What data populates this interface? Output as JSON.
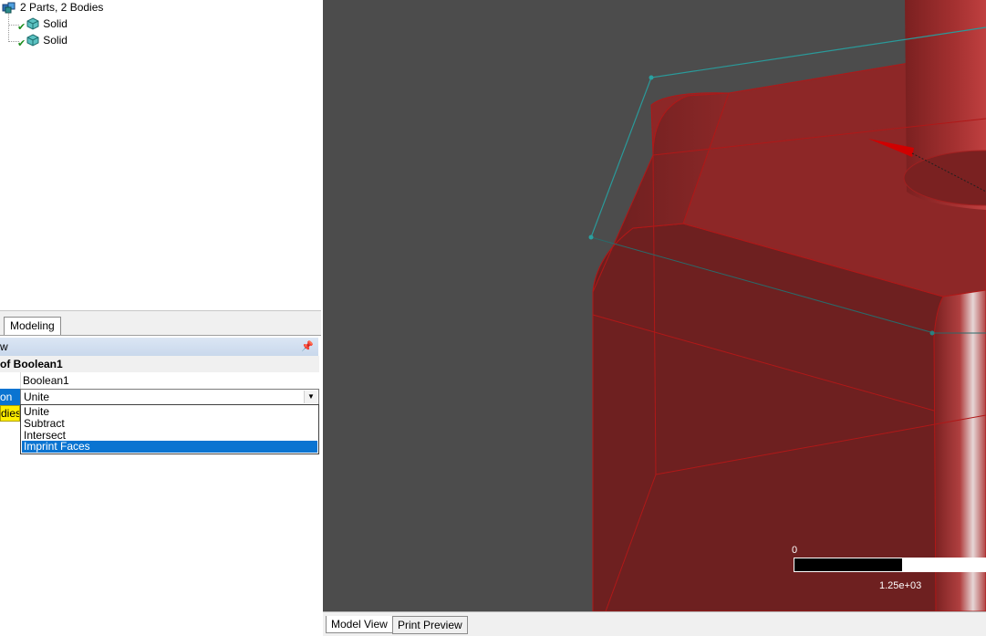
{
  "tree": {
    "root_label": "2 Parts, 2 Bodies",
    "children": [
      {
        "label": "Solid",
        "icon": "solid-body-icon",
        "status": "check"
      },
      {
        "label": "Solid",
        "icon": "solid-body-icon",
        "status": "check"
      }
    ]
  },
  "tabs": {
    "modeling": "Modeling"
  },
  "details": {
    "header": "w",
    "title": "of Boolean1",
    "rows": [
      {
        "name": "",
        "value": "Boolean1"
      },
      {
        "name": "on",
        "value": "Unite"
      },
      {
        "name": "dies",
        "value": ""
      }
    ],
    "dropdown": {
      "selected": "Unite",
      "options": [
        "Unite",
        "Subtract",
        "Intersect",
        "Imprint Faces"
      ],
      "highlighted": "Imprint Faces"
    }
  },
  "viewport": {
    "scale_zero": "0",
    "scale_value": "1.25e+03",
    "body_color": "#8b2626",
    "background": "#4c4c4c"
  },
  "bottom_tabs": {
    "model_view": "Model View",
    "print_preview": "Print Preview"
  }
}
